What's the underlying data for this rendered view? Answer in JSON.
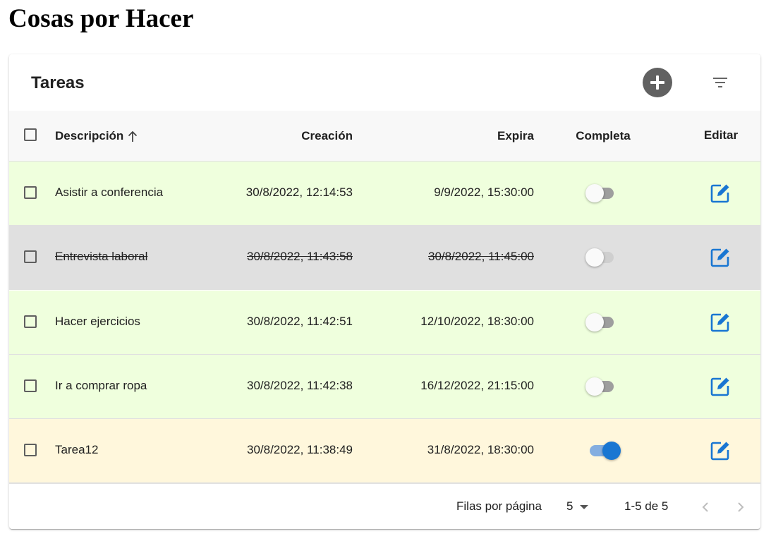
{
  "page_title": "Cosas por Hacer",
  "toolbar": {
    "title": "Tareas",
    "add_icon": "add-circle-icon",
    "filter_icon": "filter-list-icon"
  },
  "table": {
    "headers": {
      "description": "Descripción",
      "created": "Creación",
      "expires": "Expira",
      "complete": "Completa",
      "edit": "Editar"
    },
    "sort": {
      "column": "description",
      "direction": "asc",
      "icon": "arrow-up-icon"
    },
    "rows": [
      {
        "description": "Asistir a conferencia",
        "created": "30/8/2022, 12:14:53",
        "expires": "9/9/2022, 15:30:00",
        "complete": false,
        "status": "pending",
        "bg": "#efffdd"
      },
      {
        "description": "Entrevista laboral",
        "created": "30/8/2022, 11:43:58",
        "expires": "30/8/2022, 11:45:00",
        "complete": false,
        "status": "expired",
        "bg": "#e0e0e0"
      },
      {
        "description": "Hacer ejercicios",
        "created": "30/8/2022, 11:42:51",
        "expires": "12/10/2022, 18:30:00",
        "complete": false,
        "status": "pending",
        "bg": "#efffdd"
      },
      {
        "description": "Ir a comprar ropa",
        "created": "30/8/2022, 11:42:38",
        "expires": "16/12/2022, 21:15:00",
        "complete": false,
        "status": "pending",
        "bg": "#efffdd"
      },
      {
        "description": "Tarea12",
        "created": "30/8/2022, 11:38:49",
        "expires": "31/8/2022, 18:30:00",
        "complete": true,
        "status": "completed",
        "bg": "#fff7dc"
      }
    ]
  },
  "pagination": {
    "rows_per_page_label": "Filas por página",
    "rows_per_page": "5",
    "range": "1-5 de 5",
    "prev_icon": "chevron-left-icon",
    "next_icon": "chevron-right-icon"
  },
  "colors": {
    "accent": "#1976d2",
    "edit_icon": "#1976d2",
    "switch_track_off": "#9e9e9e",
    "switch_track_on": "#84aee0",
    "add_button": "#616161"
  }
}
